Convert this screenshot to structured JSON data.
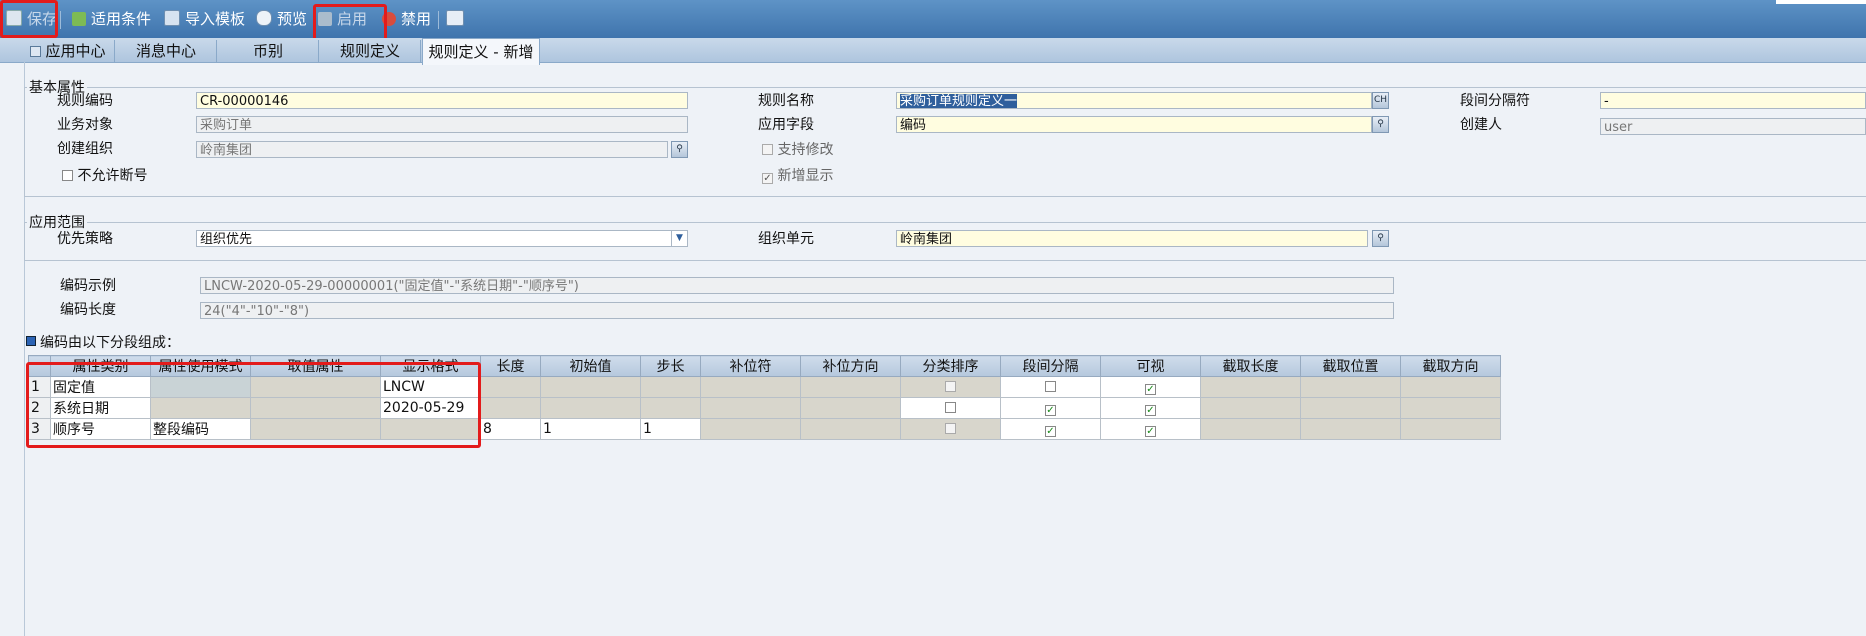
{
  "toolbar": {
    "save": "保存",
    "conditions": "适用条件",
    "import_template": "导入模板",
    "preview": "预览",
    "enable": "启用",
    "disable": "禁用"
  },
  "tabs": [
    "应用中心",
    "消息中心",
    "币别",
    "规则定义",
    "规则定义 - 新增"
  ],
  "basic": {
    "legend": "基本属性",
    "rule_code_label": "规则编码",
    "rule_code_value": "CR-00000146",
    "rule_name_label": "规则名称",
    "rule_name_value": "采购订单规则定义一",
    "rule_name_lang": "CH",
    "separator_label": "段间分隔符",
    "separator_value": "-",
    "biz_object_label": "业务对象",
    "biz_object_value": "采购订单",
    "apply_field_label": "应用字段",
    "apply_field_value": "编码",
    "creator_label": "创建人",
    "creator_value": "user",
    "create_org_label": "创建组织",
    "create_org_value": "岭南集团",
    "support_modify_label": "支持修改",
    "no_break_label": "不允许断号",
    "show_on_new_label": "新增显示"
  },
  "scope": {
    "legend": "应用范围",
    "priority_label": "优先策略",
    "priority_value": "组织优先",
    "org_unit_label": "组织单元",
    "org_unit_value": "岭南集团"
  },
  "example": {
    "code_example_label": "编码示例",
    "code_example_value": "LNCW-2020-05-29-00000001(\"固定值\"-\"系统日期\"-\"顺序号\")",
    "code_length_label": "编码长度",
    "code_length_value": "24(\"4\"-\"10\"-\"8\")"
  },
  "segments": {
    "title": "编码由以下分段组成：",
    "columns": [
      "属性类别",
      "属性使用模式",
      "取值属性",
      "显示格式",
      "长度",
      "初始值",
      "步长",
      "补位符",
      "补位方向",
      "分类排序",
      "段间分隔",
      "可视",
      "截取长度",
      "截取位置",
      "截取方向"
    ],
    "rows": [
      {
        "no": "1",
        "category": "固定值",
        "mode": "",
        "attr": "",
        "format": "LNCW",
        "length": "",
        "init": "",
        "step": "",
        "pad": "",
        "pad_dir": "",
        "sort": false,
        "sep": false,
        "visible": true
      },
      {
        "no": "2",
        "category": "系统日期",
        "mode": "",
        "attr": "",
        "format": "2020-05-29",
        "length": "",
        "init": "",
        "step": "",
        "pad": "",
        "pad_dir": "",
        "sort": false,
        "sep": true,
        "visible": true
      },
      {
        "no": "3",
        "category": "顺序号",
        "mode": "整段编码",
        "attr": "",
        "format": "",
        "length": "8",
        "init": "1",
        "step": "1",
        "pad": "",
        "pad_dir": "",
        "sort": false,
        "sep": true,
        "visible": true
      }
    ]
  },
  "colors": {
    "toolbar": "#4a80b8",
    "highlight": "#e31b1b",
    "required_field": "#fffde0",
    "check_mark": "#1a8a1a"
  }
}
